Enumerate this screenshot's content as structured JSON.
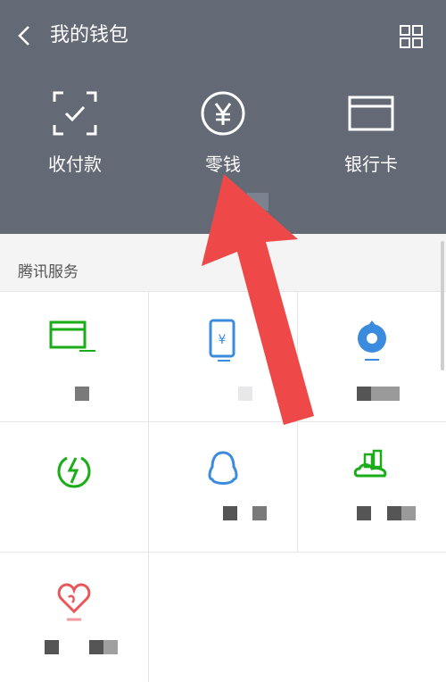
{
  "header": {
    "title": "我的钱包",
    "actions": [
      {
        "label": "收付款",
        "icon": "scan-check-icon"
      },
      {
        "label": "零钱",
        "icon": "yen-circle-icon"
      },
      {
        "label": "银行卡",
        "icon": "bank-card-icon"
      }
    ]
  },
  "services": {
    "title": "腾讯服务",
    "items": [
      {
        "icon": "credit-card-repay-icon",
        "color": "#1aad19"
      },
      {
        "icon": "phone-topup-icon",
        "color": "#3b8bde"
      },
      {
        "icon": "wealth-management-icon",
        "color": "#3b8bde"
      },
      {
        "icon": "utility-bill-icon",
        "color": "#1aad19"
      },
      {
        "icon": "qq-icon",
        "color": "#3b8bde"
      },
      {
        "icon": "city-service-icon",
        "color": "#1aad19"
      },
      {
        "icon": "charity-heart-icon",
        "color": "#e9565a"
      }
    ]
  },
  "colors": {
    "header_bg": "#646a75",
    "accent_green": "#1aad19",
    "accent_blue": "#3b8bde",
    "arrow_red": "#ef4848"
  }
}
